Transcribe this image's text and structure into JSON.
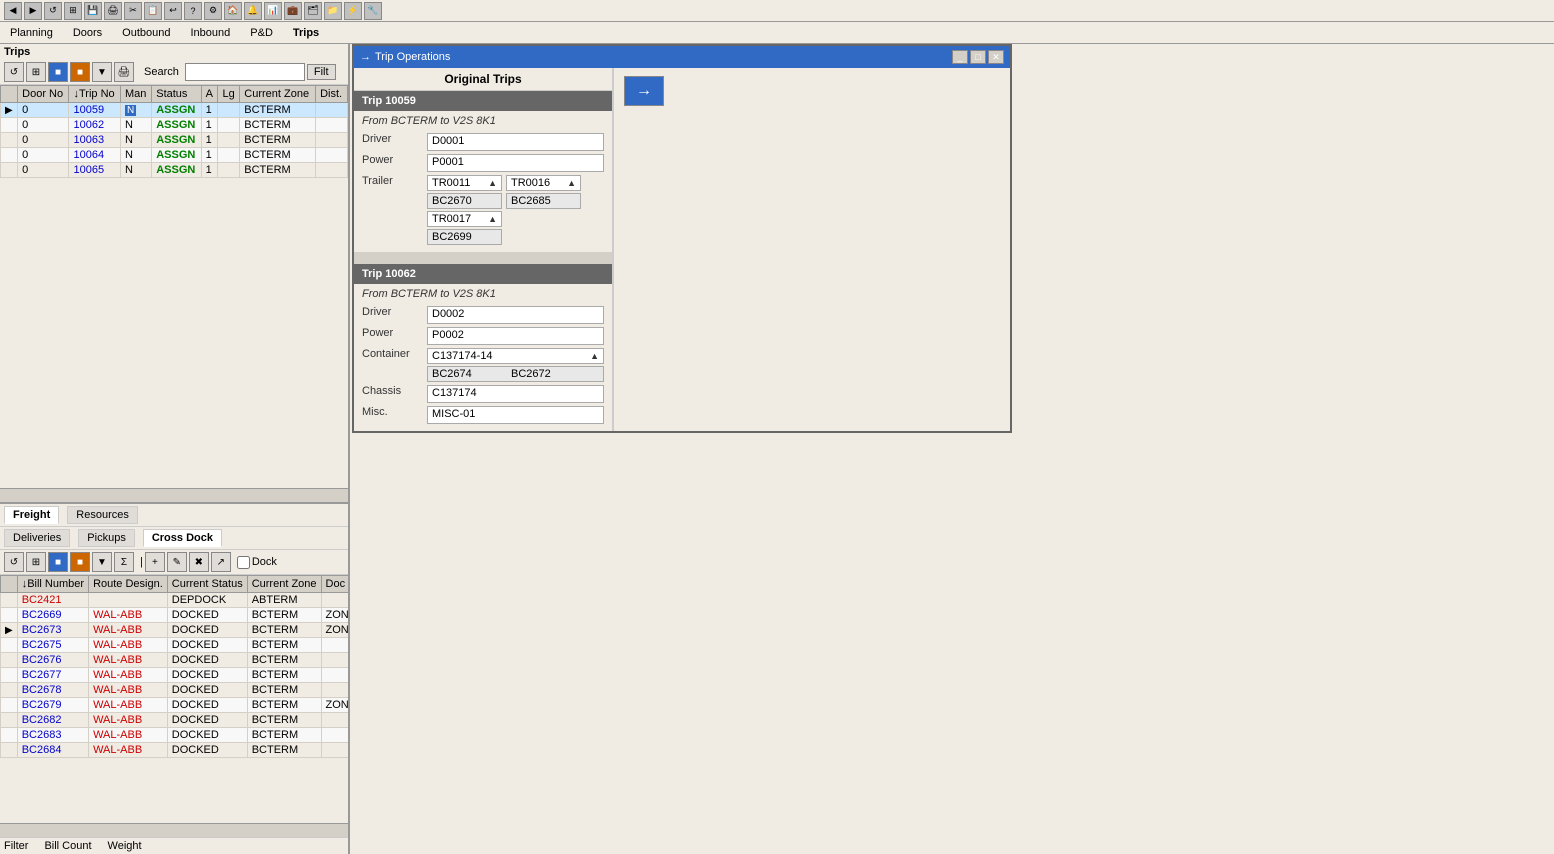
{
  "toolbar": {
    "icons": [
      "◀",
      "▶",
      "↺",
      "⊞",
      "💾",
      "🖨",
      "✂",
      "📋",
      "↩",
      "?",
      "⚙",
      "🏠",
      "🔔",
      "📊",
      "💼",
      "🗂",
      "📁",
      "⚡",
      "🔧"
    ]
  },
  "menu": {
    "items": [
      "Planning",
      "Doors",
      "Outbound",
      "Inbound",
      "P&D",
      "Trips"
    ]
  },
  "trips": {
    "section_label": "Trips",
    "search_label": "Search",
    "filter_label": "Filt",
    "columns": [
      "Door No",
      "↓Trip No",
      "Man",
      "Status",
      "A",
      "Lg",
      "Current Zone",
      "Dist."
    ],
    "rows": [
      {
        "indicator": "▶",
        "door": "0",
        "trip": "10059",
        "man": "N",
        "status": "ASSGN",
        "a": "1",
        "lg": "",
        "zone": "BCTERM",
        "dist": ""
      },
      {
        "indicator": "",
        "door": "0",
        "trip": "10062",
        "man": "N",
        "status": "ASSGN",
        "a": "1",
        "lg": "",
        "zone": "BCTERM",
        "dist": ""
      },
      {
        "indicator": "",
        "door": "0",
        "trip": "10063",
        "man": "N",
        "status": "ASSGN",
        "a": "1",
        "lg": "",
        "zone": "BCTERM",
        "dist": ""
      },
      {
        "indicator": "",
        "door": "0",
        "trip": "10064",
        "man": "N",
        "status": "ASSGN",
        "a": "1",
        "lg": "",
        "zone": "BCTERM",
        "dist": ""
      },
      {
        "indicator": "",
        "door": "0",
        "trip": "10065",
        "man": "N",
        "status": "ASSGN",
        "a": "1",
        "lg": "",
        "zone": "BCTERM",
        "dist": ""
      }
    ]
  },
  "freight": {
    "tabs": [
      "Freight",
      "Resources"
    ],
    "sub_tabs": [
      "Deliveries",
      "Pickups",
      "Cross Dock"
    ],
    "active_tab": "Freight",
    "active_sub_tab": "Cross Dock",
    "dock_label": "Dock",
    "columns": [
      "↓Bill Number",
      "Route Design.",
      "Current Status",
      "Current Zone",
      "Doc"
    ],
    "rows": [
      {
        "bill": "BC2421",
        "route": "",
        "status": "DEPDOCK",
        "zone": "ABTERM",
        "doc": ""
      },
      {
        "bill": "BC2669",
        "route": "WAL-ABB",
        "status": "DOCKED",
        "zone": "BCTERM",
        "doc": "ZON"
      },
      {
        "bill": "BC2673",
        "route": "WAL-ABB",
        "status": "DOCKED",
        "zone": "BCTERM",
        "doc": "ZON",
        "indicator": "▶"
      },
      {
        "bill": "BC2675",
        "route": "WAL-ABB",
        "status": "DOCKED",
        "zone": "BCTERM",
        "doc": ""
      },
      {
        "bill": "BC2676",
        "route": "WAL-ABB",
        "status": "DOCKED",
        "zone": "BCTERM",
        "doc": ""
      },
      {
        "bill": "BC2677",
        "route": "WAL-ABB",
        "status": "DOCKED",
        "zone": "BCTERM",
        "doc": ""
      },
      {
        "bill": "BC2678",
        "route": "WAL-ABB",
        "status": "DOCKED",
        "zone": "BCTERM",
        "doc": ""
      },
      {
        "bill": "BC2679",
        "route": "WAL-ABB",
        "status": "DOCKED",
        "zone": "BCTERM",
        "doc": "ZON"
      },
      {
        "bill": "BC2682",
        "route": "WAL-ABB",
        "status": "DOCKED",
        "zone": "BCTERM",
        "doc": ""
      },
      {
        "bill": "BC2683",
        "route": "WAL-ABB",
        "status": "DOCKED",
        "zone": "BCTERM",
        "doc": ""
      },
      {
        "bill": "BC2684",
        "route": "WAL-ABB",
        "status": "DOCKED",
        "zone": "BCTERM",
        "doc": ""
      }
    ]
  },
  "trip_ops": {
    "window_title": "Trip Operations",
    "title_icon": "→",
    "panel_title": "Original Trips",
    "arrow_icon": "→",
    "trips": [
      {
        "id": "Trip 10059",
        "route": "From BCTERM to V2S 8K1",
        "driver": "D0001",
        "power": "P0001",
        "trailers": [
          {
            "code": "TR0011",
            "sub": "BC2670"
          },
          {
            "code": "TR0016",
            "sub": "BC2685"
          },
          {
            "code": "TR0017",
            "sub": "BC2699"
          }
        ]
      },
      {
        "id": "Trip 10062",
        "route": "From BCTERM to V2S 8K1",
        "driver": "D0002",
        "power": "P0002",
        "container": "C137174-14",
        "container_subs": [
          "BC2674",
          "BC2672"
        ],
        "chassis": "C137174",
        "misc": "MISC-01"
      }
    ]
  },
  "bottom_bar": {
    "filter_label": "Filter",
    "bill_count_label": "Bill Count",
    "weight_label": "Weight"
  }
}
